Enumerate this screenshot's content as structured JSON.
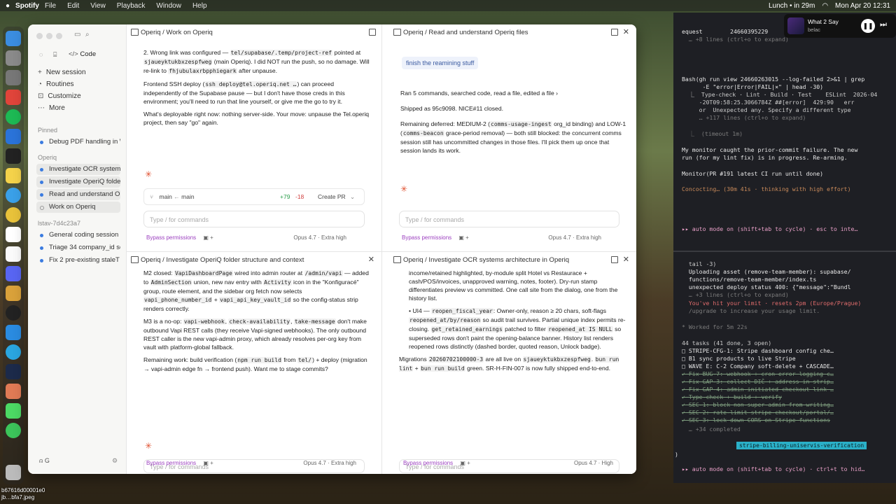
{
  "menubar": {
    "app": "Spotify",
    "items": [
      "File",
      "Edit",
      "View",
      "Playback",
      "Window",
      "Help"
    ],
    "reminder": "Lunch • in 29m",
    "clock": "Mon Apr 20  12:31"
  },
  "nowplaying": {
    "title": "What 2 Say",
    "artist": "belac"
  },
  "sidebar": {
    "code_label": "Code",
    "nav": [
      "New session",
      "Routines",
      "Customize",
      "More"
    ],
    "pinned_label": "Pinned",
    "pinned": [
      "Debug PDF handling in W"
    ],
    "group1_label": "Operiq",
    "group1": [
      "Investigate OCR system",
      "Investigate OperiQ folde",
      "Read and understand O",
      "Work on Operiq"
    ],
    "group2_label": "lstav-7d4c23a7",
    "group2": [
      "General coding session",
      "Triage 34 company_id sc",
      "Fix 2 pre-existing staleT"
    ]
  },
  "pane_tl": {
    "title": "Operiq / Work on Operiq",
    "list_item": "2. Wrong link was configured — ",
    "code1": "tel/supabase/.temp/project-ref",
    "line1b": " pointed at ",
    "code2": "sjaueyktukbxzespfweg",
    "line1c": " (main Operiq). I did NOT run the push, so no damage. Will re-link to ",
    "code3": "fhjubulaxrbpphiegark",
    "line1d": " after unpause.",
    "p2a": "Frontend SSH deploy (",
    "code4": "ssh deploy@tel.operiq.net …",
    "p2b": ") can proceed independently of the Supabase pause — but I don't have those creds in this environment; you'll need to run that line yourself, or give me the go to try it.",
    "p3": "What's deployable right now: nothing server-side. Your move: unpause the Tel.operiq project, then say \"go\" again.",
    "branch_from": "main",
    "branch_to": "main",
    "adds": "+79",
    "dels": "-18",
    "create_pr": "Create PR",
    "input_placeholder": "Type / for commands",
    "bypass": "Bypass permissions",
    "model": "Opus 4.7 · Extra high"
  },
  "pane_tr": {
    "title": "Operiq / Read and understand Operiq files",
    "chip": "finish the reamining stuff",
    "summary": "Ran 5 commands, searched code, read a file, edited a file ›",
    "shipped": "Shipped as 95c9098. NICE#11 closed.",
    "p1a": "Remaining deferred: MEDIUM-2 (",
    "code1": "comms-usage-ingest",
    "p1b": " org_id binding) and LOW-1 (",
    "code2": "comms-beacon",
    "p1c": " grace-period removal) — both still blocked: the concurrent comms session still has uncommitted changes in those files. I'll pick them up once that session lands its work.",
    "input_placeholder": "Type / for commands",
    "bypass": "Bypass permissions",
    "model": "Opus 4.7 · Extra high"
  },
  "pane_bl": {
    "title": "Operiq / Investigate OperiQ folder structure and context",
    "p0a": "M2 closed: ",
    "code0": "VapiDashboardPage",
    "p0b": " wired into admin router at ",
    "code0b": "/admin/vapi",
    "p0c": " — added to ",
    "code1": "AdminSection",
    "p0d": " union, new nav entry with ",
    "code2": "Activity",
    "p0e": " icon in the \"Konfiguracé\" group, route element, and the sidebar org fetch now selects ",
    "code3": "vapi_phone_number_id",
    "p0f": " + ",
    "code4": "vapi_api_key_vault_id",
    "p0g": " so the config-status strip renders correctly.",
    "p1a": "M3 is a no-op: ",
    "code5": "vapi-webhook",
    "p1b": ", ",
    "code6": "check-availability",
    "p1c": ", ",
    "code7": "take-message",
    "p1d": " don't make outbound Vapi REST calls (they receive Vapi-signed webhooks). The only outbound REST caller is the new vapi-admin proxy, which already resolves per-org key from vault with platform-global fallback.",
    "p2a": "Remaining work: build verification (",
    "code8": "npm run build",
    "p2b": " from ",
    "code9": "tel/",
    "p2c": ") + deploy (migration → vapi-admin edge fn → frontend push). Want me to stage commits?",
    "input_placeholder": "Type / for commands",
    "bypass": "Bypass permissions",
    "model": "Opus 4.7 · Extra high"
  },
  "pane_br": {
    "title": "Operiq / Investigate OCR systems architecture in Operiq",
    "p0": "income/retained highlighted, by-module split Hotel vs Restaurace + cash/POS/invoices, unapproved warning, notes, footer). Dry-run stamp differentiates preview vs committed. One call site from the dialog, one from the history list.",
    "li_a": "UI4 — ",
    "code1": "reopen_fiscal_year",
    "li_b": ": Owner-only, reason ≥ 20 chars, soft-flags ",
    "code2": "reopened_at/by/reason",
    "li_c": " so audit trail survives. Partial unique index permits re-closing. ",
    "code3": "get_retained_earnings",
    "li_d": " patched to filter ",
    "code4": "reopened_at IS NULL",
    "li_e": " so superseded rows don't paint the opening-balance banner. History list renders reopened rows distinctly (dashed border, quoted reason, Unlock badge).",
    "p2a": "Migrations ",
    "code5": "20260702100000-3",
    "p2b": " are all live on ",
    "code6": "sjaueyktukbxzespfweg",
    "p2c": ". ",
    "code7": "bun run lint",
    "p2d": " + ",
    "code8": "bun run build",
    "p2e": " green. SR-H-FIN-007 is now fully shipped end-to-end.",
    "input_placeholder": "Type / for commands",
    "bypass": "Bypass permissions",
    "model": "Opus 4.7 · High"
  },
  "terminal_top": {
    "l1": "equest        24660395229",
    "l2": "  … +8 lines (ctrl+o to expand)",
    "l3": "Bash(gh run view 24660263015 --log-failed 2>&1 | grep",
    "l4": "      -E \"error|Error|FAIL|×\" | head -30)",
    "l5": "  ⎿  Type-check · Lint · Build · Test    ESLint  2026-04",
    "l6": "     -20T09:58:25.3066784Z ##[error]  429:90   err",
    "l7": "     or  Unexpected any. Specify a different type",
    "l8": "     … +117 lines (ctrl+o to expand)",
    "l9": "  ⎿  (timeout 1m)",
    "l10": "My monitor caught the prior-commit failure. The new",
    "l11": "run (for my lint fix) is in progress. Re-arming.",
    "l12": "Monitor(PR #191 latest CI run until done)",
    "l13": "Concocting… (30m 41s · thinking with high effort)",
    "l14": "▸▸ auto mode on (shift+tab to cycle) · esc to inte…"
  },
  "terminal_bottom": {
    "l1": "  tail -3)",
    "l2": "  Uploading asset (remove-team-member): supabase/",
    "l3": "  functions/remove-team-member/index.ts",
    "l4": "  unexpected deploy status 400: {\"message\":\"Bundl",
    "l5": "  … +3 lines (ctrl+o to expand)",
    "l6": "  You've hit your limit · resets 2pm (Europe/Prague)",
    "l7": "  /upgrade to increase your usage limit.",
    "l8": "* Worked for 5m 22s",
    "l9": "44 tasks (41 done, 3 open)",
    "tasks_open": [
      "□ STRIPE-CFG-1: Stripe dashboard config che…",
      "□ B1 sync products to live Stripe",
      "□ WAVE E: C-2 Company soft-delete + CASCADE…"
    ],
    "tasks_done": [
      "✓ Fix BUG-7: webhook + cron error logging c…",
      "✓ Fix GAP-3: collect DIČ + address in strip…",
      "✓ Fix GAP-4: admin-initiated checkout link …",
      "✓ Type-check + build + verify",
      "✓ SEC-1: block non-super-admin from writing…",
      "✓ SEC-2: rate-limit stripe-checkout/portal/…",
      "✓ SEC-3: lock down CORS on Stripe functions"
    ],
    "more": "  … +34 completed",
    "badge": "stripe-billing-uniservis-verification",
    "prompt": ")",
    "mode": "▸▸ auto mode on (shift+tab to cycle) · ctrl+t to hid…"
  },
  "desktop_label": {
    "l1": "b67616d00001e0",
    "l2": "jb…bfa7.jpeg"
  },
  "colors": {
    "accent": "#9b3fbf",
    "spark": "#e05030",
    "terminal_bg": "#1e1f24"
  }
}
